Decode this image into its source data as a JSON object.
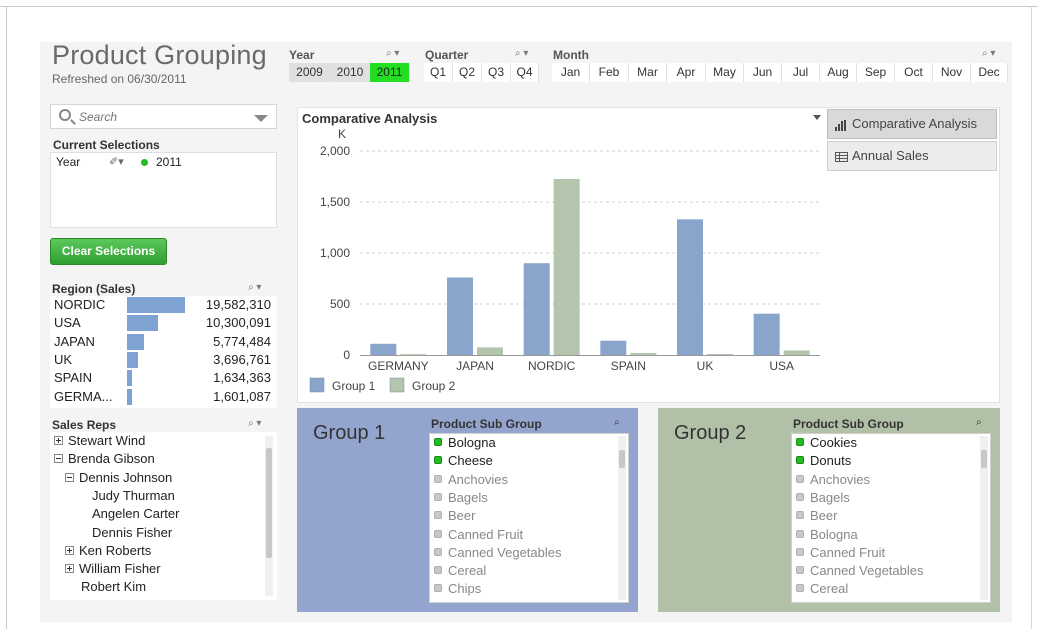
{
  "header": {
    "title": "Product Grouping",
    "refreshed": "Refreshed on 06/30/2011"
  },
  "filters": {
    "year": {
      "label": "Year",
      "options": [
        "2009",
        "2010",
        "2011"
      ],
      "selected": "2011"
    },
    "quarter": {
      "label": "Quarter",
      "options": [
        "Q1",
        "Q2",
        "Q3",
        "Q4"
      ]
    },
    "month": {
      "label": "Month",
      "options": [
        "Jan",
        "Feb",
        "Mar",
        "Apr",
        "May",
        "Jun",
        "Jul",
        "Aug",
        "Sep",
        "Oct",
        "Nov",
        "Dec"
      ]
    }
  },
  "search": {
    "placeholder": "Search"
  },
  "current_selections": {
    "title": "Current Selections",
    "field": "Year",
    "value": "2011"
  },
  "clear_button": "Clear Selections",
  "region": {
    "title": "Region (Sales)",
    "rows": [
      {
        "name": "NORDIC",
        "value": "19,582,310",
        "amount": 19582310
      },
      {
        "name": "USA",
        "value": "10,300,091",
        "amount": 10300091
      },
      {
        "name": "JAPAN",
        "value": "5,774,484",
        "amount": 5774484
      },
      {
        "name": "UK",
        "value": "3,696,761",
        "amount": 3696761
      },
      {
        "name": "SPAIN",
        "value": "1,634,363",
        "amount": 1634363
      },
      {
        "name": "GERMA...",
        "value": "1,601,087",
        "amount": 1601087
      }
    ]
  },
  "sales_reps": {
    "title": "Sales Reps",
    "items": [
      {
        "name": "Stewart Wind",
        "toggle": "plus",
        "level": 0
      },
      {
        "name": "Brenda Gibson",
        "toggle": "minus",
        "level": 0
      },
      {
        "name": "Dennis Johnson",
        "toggle": "minus",
        "level": 1
      },
      {
        "name": "Judy Thurman",
        "toggle": "",
        "level": 2
      },
      {
        "name": "Angelen Carter",
        "toggle": "",
        "level": 2
      },
      {
        "name": "Dennis Fisher",
        "toggle": "",
        "level": 2
      },
      {
        "name": "Ken Roberts",
        "toggle": "plus",
        "level": 1
      },
      {
        "name": "William Fisher",
        "toggle": "plus",
        "level": 1
      },
      {
        "name": "Robert Kim",
        "toggle": "",
        "level": 1
      }
    ]
  },
  "tabs": [
    {
      "label": "Comparative Analysis",
      "icon": "bar-chart-icon",
      "active": true
    },
    {
      "label": "Annual Sales",
      "icon": "table-icon",
      "active": false
    }
  ],
  "chart_data": {
    "type": "bar",
    "title": "Comparative Analysis",
    "ylabel": "K",
    "categories": [
      "GERMANY",
      "JAPAN",
      "NORDIC",
      "SPAIN",
      "UK",
      "USA"
    ],
    "series": [
      {
        "name": "Group 1",
        "color": "#8aa5cb",
        "values": [
          110,
          760,
          900,
          140,
          1330,
          405
        ]
      },
      {
        "name": "Group 2",
        "color": "#b3c6ad",
        "values": [
          8,
          75,
          1725,
          20,
          10,
          45
        ]
      }
    ],
    "yticks": [
      0,
      500,
      1000,
      1500,
      2000
    ],
    "ytick_labels": [
      "0",
      "500",
      "1,000",
      "1,500",
      "2,000"
    ],
    "ylim": [
      0,
      2000
    ],
    "grid": true,
    "legend": "bottom-left"
  },
  "group1": {
    "label": "Group 1",
    "list_title": "Product Sub Group",
    "items": [
      {
        "name": "Bologna",
        "on": true
      },
      {
        "name": "Cheese",
        "on": true
      },
      {
        "name": "Anchovies",
        "on": false
      },
      {
        "name": "Bagels",
        "on": false
      },
      {
        "name": "Beer",
        "on": false
      },
      {
        "name": "Canned Fruit",
        "on": false
      },
      {
        "name": "Canned Vegetables",
        "on": false
      },
      {
        "name": "Cereal",
        "on": false
      },
      {
        "name": "Chips",
        "on": false
      }
    ]
  },
  "group2": {
    "label": "Group 2",
    "list_title": "Product Sub Group",
    "items": [
      {
        "name": "Cookies",
        "on": true
      },
      {
        "name": "Donuts",
        "on": true
      },
      {
        "name": "Anchovies",
        "on": false
      },
      {
        "name": "Bagels",
        "on": false
      },
      {
        "name": "Beer",
        "on": false
      },
      {
        "name": "Bologna",
        "on": false
      },
      {
        "name": "Canned Fruit",
        "on": false
      },
      {
        "name": "Canned Vegetables",
        "on": false
      },
      {
        "name": "Cereal",
        "on": false
      }
    ]
  }
}
